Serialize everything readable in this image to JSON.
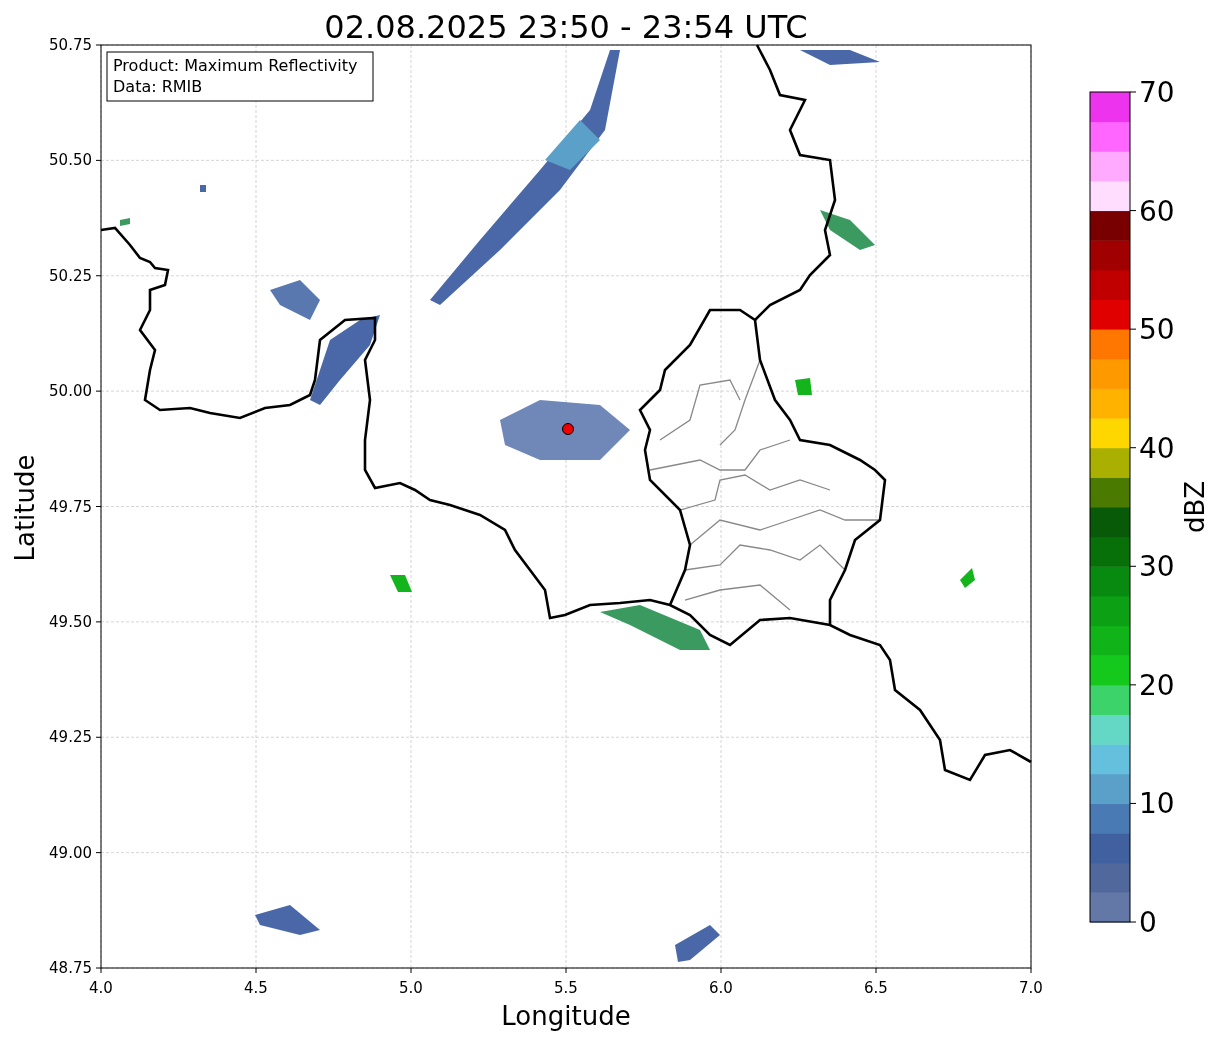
{
  "title": "02.08.2025 23:50 - 23:54 UTC",
  "info_box": {
    "lines": [
      "Product: Maximum Reflectivity",
      "Data: RMIB"
    ]
  },
  "x_axis": {
    "label": "Longitude",
    "ticks": [
      "4.0",
      "4.5",
      "5.0",
      "5.5",
      "6.0",
      "6.5",
      "7.0"
    ]
  },
  "y_axis": {
    "label": "Latitude",
    "ticks": [
      "50.75",
      "50.50",
      "50.25",
      "50.00",
      "49.75",
      "49.50",
      "49.25",
      "49.00",
      "48.75"
    ]
  },
  "colorbar": {
    "label": "dBZ",
    "ticks": [
      "70",
      "60",
      "50",
      "40",
      "30",
      "20",
      "10",
      "0"
    ],
    "segments": [
      {
        "color": "#6478a8"
      },
      {
        "color": "#50689c"
      },
      {
        "color": "#4060a0"
      },
      {
        "color": "#4a7ab4"
      },
      {
        "color": "#5aa0c8"
      },
      {
        "color": "#64c0dc"
      },
      {
        "color": "#64d8c4"
      },
      {
        "color": "#3cd46a"
      },
      {
        "color": "#14c81c"
      },
      {
        "color": "#10b418"
      },
      {
        "color": "#0ca014"
      },
      {
        "color": "#088a10"
      },
      {
        "color": "#087008"
      },
      {
        "color": "#085a08"
      },
      {
        "color": "#4a7a00"
      },
      {
        "color": "#aab000"
      },
      {
        "color": "#ffd700"
      },
      {
        "color": "#ffb300"
      },
      {
        "color": "#ff9900"
      },
      {
        "color": "#ff7700"
      },
      {
        "color": "#e00000"
      },
      {
        "color": "#c00000"
      },
      {
        "color": "#a00000"
      },
      {
        "color": "#780000"
      },
      {
        "color": "#ffddff"
      },
      {
        "color": "#ffaaff"
      },
      {
        "color": "#ff66ff"
      },
      {
        "color": "#ee33ee"
      }
    ]
  }
}
